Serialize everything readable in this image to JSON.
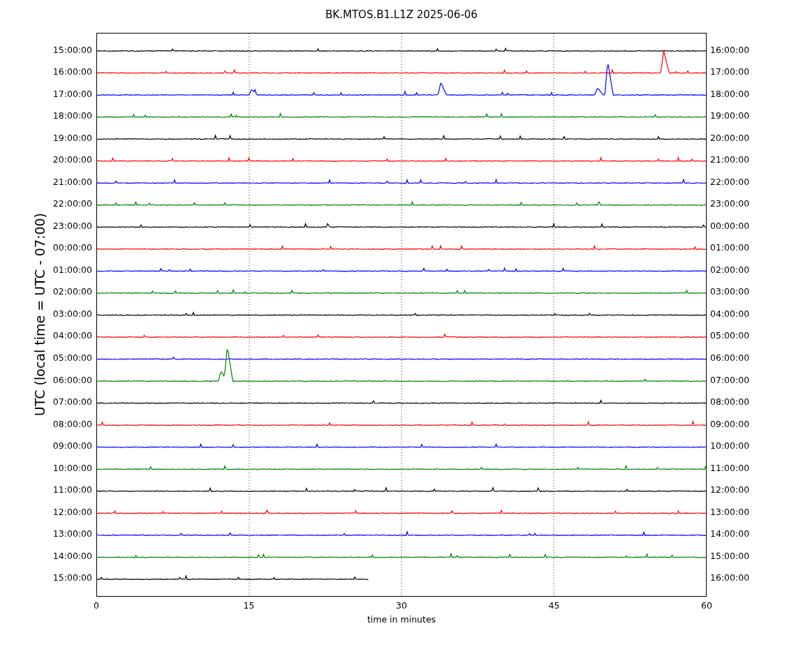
{
  "title": "BK.MTOS.B1.L1Z 2025-06-06",
  "ylabel": "UTC (local time = UTC - 07:00)",
  "xlabel": "time in minutes",
  "xticks": [
    "0",
    "15",
    "30",
    "45",
    "60"
  ],
  "rows": [
    {
      "left": "15:00:00",
      "right": "16:00:00",
      "color": "#000000",
      "level": 1
    },
    {
      "left": "16:00:00",
      "right": "17:00:00",
      "color": "#ff0000",
      "level": 1
    },
    {
      "left": "17:00:00",
      "right": "18:00:00",
      "color": "#0000ff",
      "level": 1
    },
    {
      "left": "18:00:00",
      "right": "19:00:00",
      "color": "#008000",
      "level": 1
    },
    {
      "left": "19:00:00",
      "right": "20:00:00",
      "color": "#000000",
      "level": 1
    },
    {
      "left": "20:00:00",
      "right": "21:00:00",
      "color": "#ff0000",
      "level": 1
    },
    {
      "left": "21:00:00",
      "right": "22:00:00",
      "color": "#0000ff",
      "level": 1
    },
    {
      "left": "22:00:00",
      "right": "23:00:00",
      "color": "#008000",
      "level": 1
    },
    {
      "left": "23:00:00",
      "right": "00:00:00",
      "color": "#000000",
      "level": 1
    },
    {
      "left": "00:00:00",
      "right": "01:00:00",
      "color": "#ff0000",
      "level": 1
    },
    {
      "left": "01:00:00",
      "right": "02:00:00",
      "color": "#0000ff",
      "level": 1
    },
    {
      "left": "02:00:00",
      "right": "03:00:00",
      "color": "#008000",
      "level": 1
    },
    {
      "left": "03:00:00",
      "right": "04:00:00",
      "color": "#000000",
      "level": 1
    },
    {
      "left": "04:00:00",
      "right": "05:00:00",
      "color": "#ff0000",
      "level": 1
    },
    {
      "left": "05:00:00",
      "right": "06:00:00",
      "color": "#0000ff",
      "level": 1
    },
    {
      "left": "06:00:00",
      "right": "07:00:00",
      "color": "#008000",
      "level": 1
    },
    {
      "left": "07:00:00",
      "right": "08:00:00",
      "color": "#000000",
      "level": 1
    },
    {
      "left": "08:00:00",
      "right": "09:00:00",
      "color": "#ff0000",
      "level": 1
    },
    {
      "left": "09:00:00",
      "right": "10:00:00",
      "color": "#0000ff",
      "level": 1
    },
    {
      "left": "10:00:00",
      "right": "11:00:00",
      "color": "#008000",
      "level": 1
    },
    {
      "left": "11:00:00",
      "right": "12:00:00",
      "color": "#000000",
      "level": 1
    },
    {
      "left": "12:00:00",
      "right": "13:00:00",
      "color": "#ff0000",
      "level": 1
    },
    {
      "left": "13:00:00",
      "right": "14:00:00",
      "color": "#0000ff",
      "level": 1
    },
    {
      "left": "14:00:00",
      "right": "15:00:00",
      "color": "#008000",
      "level": 1
    },
    {
      "left": "15:00:00",
      "right": "16:00:00",
      "color": "#000000",
      "level": 0.445
    }
  ]
}
